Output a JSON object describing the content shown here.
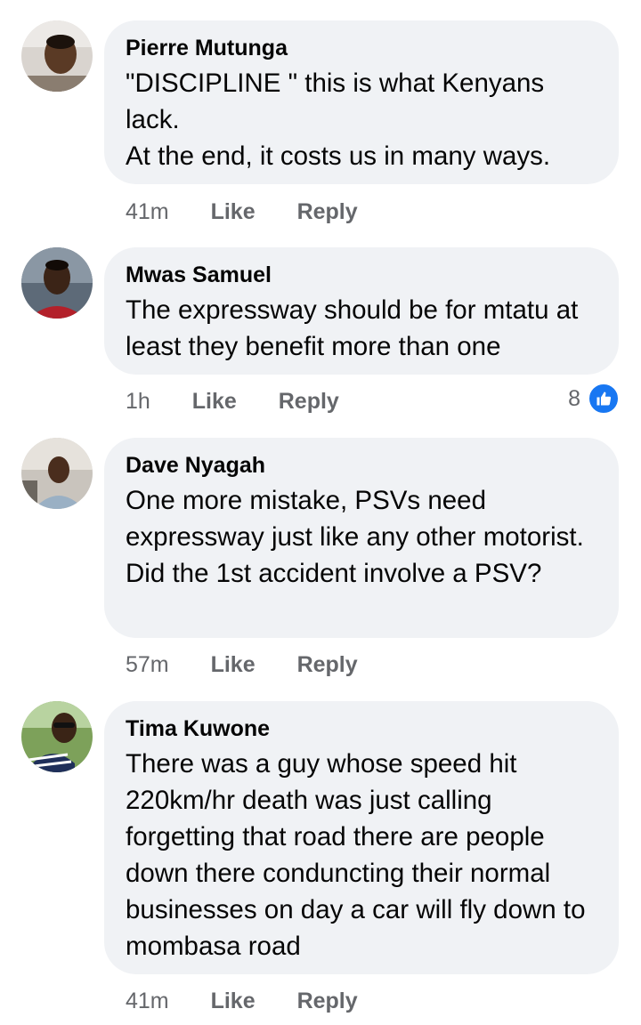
{
  "comments": [
    {
      "author": "Pierre Mutunga",
      "text": "\"DISCIPLINE \" this is what Kenyans lack.\nAt the end, it costs us in many ways.",
      "time": "41m",
      "like_label": "Like",
      "reply_label": "Reply",
      "avatar_icon": "profile-photo-icon"
    },
    {
      "author": "Mwas Samuel",
      "text": "The expressway should be for mtatu at least they benefit more than one",
      "time": "1h",
      "like_label": "Like",
      "reply_label": "Reply",
      "reaction_count": "8",
      "reaction_icon": "thumbs-up-icon",
      "avatar_icon": "profile-photo-icon"
    },
    {
      "author": "Dave Nyagah",
      "text": "One more mistake, PSVs need expressway just like any other motorist. Did the 1st accident involve a PSV?",
      "time": "57m",
      "like_label": "Like",
      "reply_label": "Reply",
      "avatar_icon": "profile-photo-icon"
    },
    {
      "author": "Tima Kuwone",
      "text": "There was a guy whose speed hit 220km/hr death was just calling forgetting that road there are people down there conduncting their normal businesses on day a car will fly down to mombasa road",
      "time": "41m",
      "like_label": "Like",
      "reply_label": "Reply",
      "avatar_icon": "profile-photo-icon"
    }
  ],
  "colors": {
    "bubble": "#f0f2f5",
    "meta_text": "#65676b",
    "like_blue": "#1877f2"
  }
}
